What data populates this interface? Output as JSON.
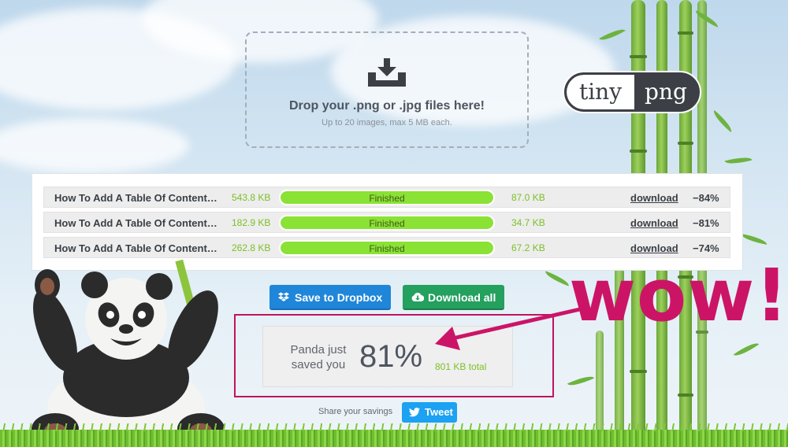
{
  "brand": {
    "logo_left": "tiny",
    "logo_right": "png"
  },
  "dropzone": {
    "title": "Drop your .png or .jpg files here!",
    "subtitle": "Up to 20 images, max 5 MB each."
  },
  "results": [
    {
      "name": "How To Add A Table Of Contents To WordPress",
      "original_size": "543.8 KB",
      "status": "Finished",
      "progress": 1.0,
      "new_size": "87.0 KB",
      "download_label": "download",
      "reduction": "−84%"
    },
    {
      "name": "How To Add A Table Of Contents To WordPress",
      "original_size": "182.9 KB",
      "status": "Finished",
      "progress": 1.0,
      "new_size": "34.7 KB",
      "download_label": "download",
      "reduction": "−81%"
    },
    {
      "name": "How To Add A Table Of Contents To WordPress",
      "original_size": "262.8 KB",
      "status": "Finished",
      "progress": 1.0,
      "new_size": "67.2 KB",
      "download_label": "download",
      "reduction": "−74%"
    }
  ],
  "actions": {
    "dropbox_label": "Save to Dropbox",
    "download_all_label": "Download all"
  },
  "savings": {
    "label_line1": "Panda just",
    "label_line2": "saved you",
    "percent": "81%",
    "total": "801 KB total"
  },
  "share": {
    "label": "Share your savings",
    "tweet_label": "Tweet"
  },
  "annotation": {
    "text": "wow!",
    "color": "#cc1467"
  },
  "colors": {
    "accent_green": "#8ae234",
    "size_text_green": "#7cbf26",
    "dropbox_blue": "#1f86d9",
    "download_green": "#24a05f",
    "twitter_blue": "#1da1f2",
    "logo_dark": "#3d3f46"
  }
}
